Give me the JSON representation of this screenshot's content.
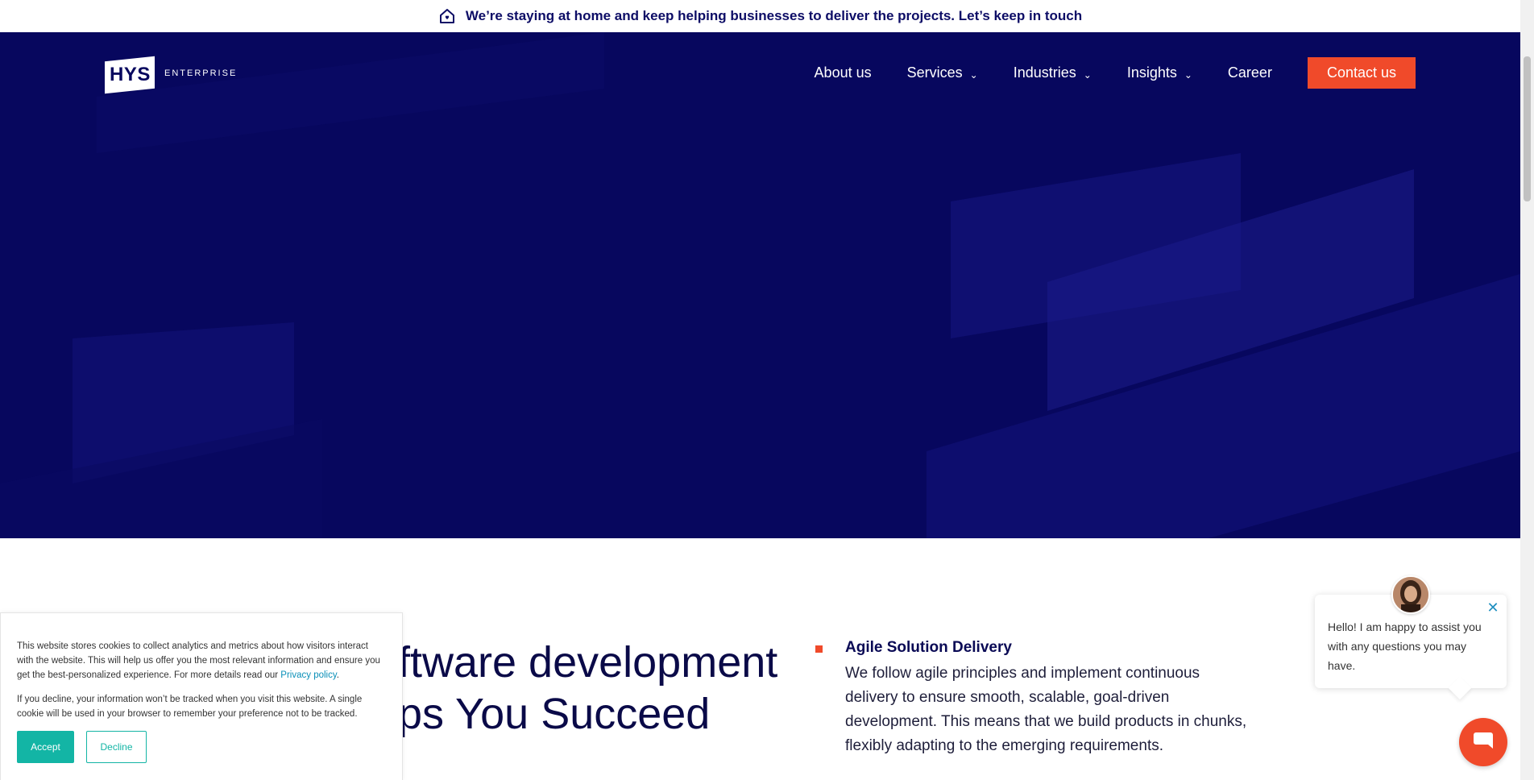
{
  "announcement": {
    "icon": "home-icon",
    "text": "We’re staying at home and keep helping businesses to deliver the projects. Let’s keep in touch"
  },
  "brand": {
    "mark": "HYS",
    "wordmark": "ENTERPRISE",
    "primary_color": "#07075e",
    "accent_color": "#f04a2a"
  },
  "nav": {
    "items": [
      {
        "label": "About us",
        "has_dropdown": false
      },
      {
        "label": "Services",
        "has_dropdown": true
      },
      {
        "label": "Industries",
        "has_dropdown": true
      },
      {
        "label": "Insights",
        "has_dropdown": true
      },
      {
        "label": "Career",
        "has_dropdown": false
      }
    ],
    "cta": "Contact us"
  },
  "main": {
    "headline_line1": "ftware development",
    "headline_line2": "ps You Succeed",
    "feature": {
      "title": "Agile Solution Delivery",
      "body": "We follow agile principles and implement continuous delivery to ensure smooth, scalable, goal-driven development. This means that we build products in chunks, flexibly adapting to the emerging requirements."
    }
  },
  "cookie_banner": {
    "text1": "This website stores cookies to collect analytics and metrics about how visitors interact with the website. This will help us offer you the most relevant information and ensure you get the best-personalized experience. For more details read our ",
    "link": "Privacy policy",
    "text1_end": ".",
    "text2": "If you decline, your information won’t be tracked when you visit this website. A single cookie will be used in your browser to remember your preference not to be tracked.",
    "accept": "Accept",
    "decline": "Decline",
    "accent_color": "#13b5a5"
  },
  "chat": {
    "message": "Hello! I am happy to assist you with any questions you may have.",
    "close_icon": "close-icon",
    "launcher_icon": "chat-icon"
  }
}
